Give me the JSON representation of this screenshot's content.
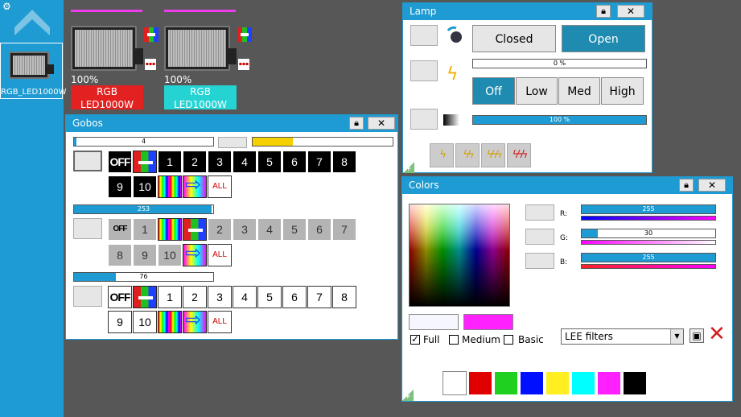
{
  "sidebar": {
    "fixture_label": "RGB_LED1000W"
  },
  "fixtures": [
    {
      "pct": "100%",
      "name_line1": "RGB",
      "name_line2": "LED1000W",
      "color": "#e32121"
    },
    {
      "pct": "100%",
      "name_line1": "RGB",
      "name_line2": "LED1000W",
      "color": "#25d3d3"
    }
  ],
  "icons": {
    "lock": "lock-icon",
    "close": "✖"
  },
  "lamp": {
    "title": "Lamp",
    "closed": "Closed",
    "open": "Open",
    "dimmer_pct": "0 %",
    "levels": [
      "Off",
      "Low",
      "Med",
      "High"
    ],
    "intensity_pct": "100 %",
    "intensity_value": 1.0,
    "dimmer_value": 0.0
  },
  "gobos": {
    "title": "Gobos",
    "wheel1": {
      "value": "4",
      "fill": 0.015,
      "labels": [
        "OFF",
        "1",
        "2",
        "3",
        "4",
        "5",
        "6",
        "7",
        "8",
        "9",
        "10",
        "ALL"
      ]
    },
    "wheel2": {
      "value": "253",
      "fill": 0.99,
      "labels": [
        "OFF",
        "1",
        "2",
        "3",
        "4",
        "5",
        "6",
        "7",
        "8",
        "9",
        "10",
        "ALL"
      ]
    },
    "wheel3": {
      "value": "76",
      "fill": 0.3,
      "labels": [
        "OFF",
        "1",
        "2",
        "3",
        "4",
        "5",
        "6",
        "7",
        "8",
        "9",
        "10",
        "ALL"
      ]
    },
    "speed_fill": 0.29
  },
  "colors": {
    "title": "Colors",
    "r_label": "R:",
    "g_label": "G:",
    "b_label": "B:",
    "r_value": "255",
    "g_value": "30",
    "b_value": "255",
    "r": 255,
    "g": 30,
    "b": 255,
    "full": "Full",
    "medium": "Medium",
    "basic": "Basic",
    "filter_select": "LEE filters",
    "swatches": [
      "#ffffff",
      "#e00000",
      "#20d020",
      "#0010ff",
      "#ffee22",
      "#00ffff",
      "#ff20ff",
      "#000000"
    ],
    "current_color": "#ff22ff",
    "prev_color": "#f6f6ff"
  }
}
